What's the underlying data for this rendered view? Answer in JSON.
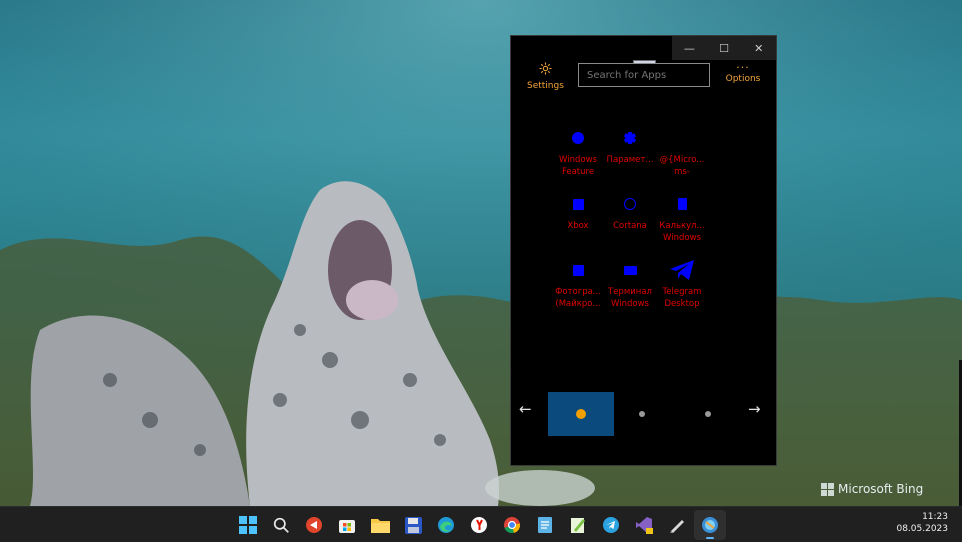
{
  "desktop": {
    "watermark": "Microsoft Bing"
  },
  "window": {
    "controls": {
      "minimize": "—",
      "maximize": "☐",
      "close": "✕"
    },
    "settings_label": "Settings",
    "options_label": "Options",
    "options_dots": "···",
    "search_placeholder": "Search for Apps",
    "apps": [
      {
        "line1": "Windows",
        "line2": "Feature",
        "icon": "circle-icon"
      },
      {
        "line1": "Парамет...",
        "line2": "",
        "icon": "gear-icon"
      },
      {
        "line1": "@{Micro...",
        "line2": "ms-",
        "icon": "blank-icon"
      },
      {
        "line1": "Xbox",
        "line2": "",
        "icon": "square-icon"
      },
      {
        "line1": "Cortana",
        "line2": "",
        "icon": "ring-icon"
      },
      {
        "line1": "Калькул...",
        "line2": "Windows",
        "icon": "calculator-icon"
      },
      {
        "line1": "Фотогра...",
        "line2": "(Майкро...",
        "icon": "photo-icon"
      },
      {
        "line1": "Терминал",
        "line2": "Windows",
        "icon": "terminal-icon"
      },
      {
        "line1": "Telegram",
        "line2": "Desktop",
        "icon": "telegram-icon"
      }
    ],
    "pager": {
      "prev": "←",
      "next": "→",
      "pages": 3,
      "current": 1
    }
  },
  "taskbar": {
    "time": "11:23",
    "date": "08.05.2023",
    "icons": [
      "start-icon",
      "search-icon",
      "app-icon",
      "store-icon",
      "explorer-icon",
      "save-icon",
      "edge-icon",
      "yandex-icon",
      "chrome-icon",
      "notepad-icon",
      "notepad-plus-icon",
      "telegram-icon",
      "visual-studio-icon",
      "pen-icon",
      "launcher-icon"
    ]
  },
  "colors": {
    "accent": "#f2a43a",
    "app_text": "#e00000",
    "app_icon": "#0000ff",
    "active_page": "#0a4a7c"
  }
}
